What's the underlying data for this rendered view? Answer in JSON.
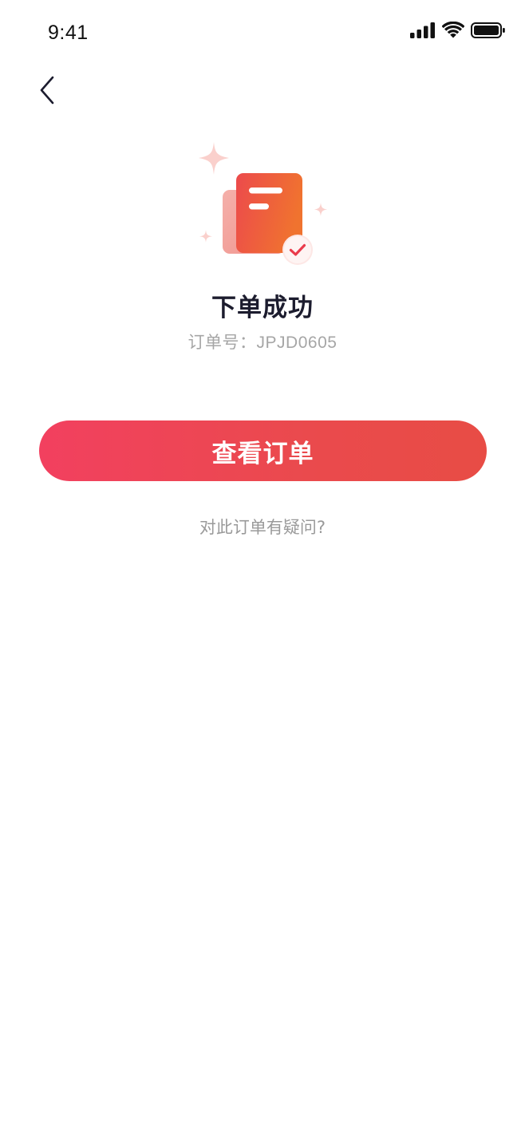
{
  "status_bar": {
    "time": "9:41",
    "icons": [
      "cellular-signal-icon",
      "wifi-icon",
      "battery-icon"
    ]
  },
  "nav": {
    "back_icon": "chevron-left-icon"
  },
  "illustration": {
    "icon": "order-document-success-icon",
    "colors": {
      "primary_start": "#ee4d4a",
      "primary_end": "#f07235",
      "back_sheet": "#f4a9a3",
      "sparkle": "#f9c8c4",
      "check": "#ea3b4b"
    }
  },
  "result": {
    "title": "下单成功",
    "order_number": "订单号：JPJD0605"
  },
  "actions": {
    "view_order_label": "查看订单",
    "question_label": "对此订单有疑问?"
  },
  "colors": {
    "button_start": "#f2405f",
    "button_end": "#e84c45",
    "title": "#1c1c2e",
    "secondary_text": "#a6a6a6"
  }
}
